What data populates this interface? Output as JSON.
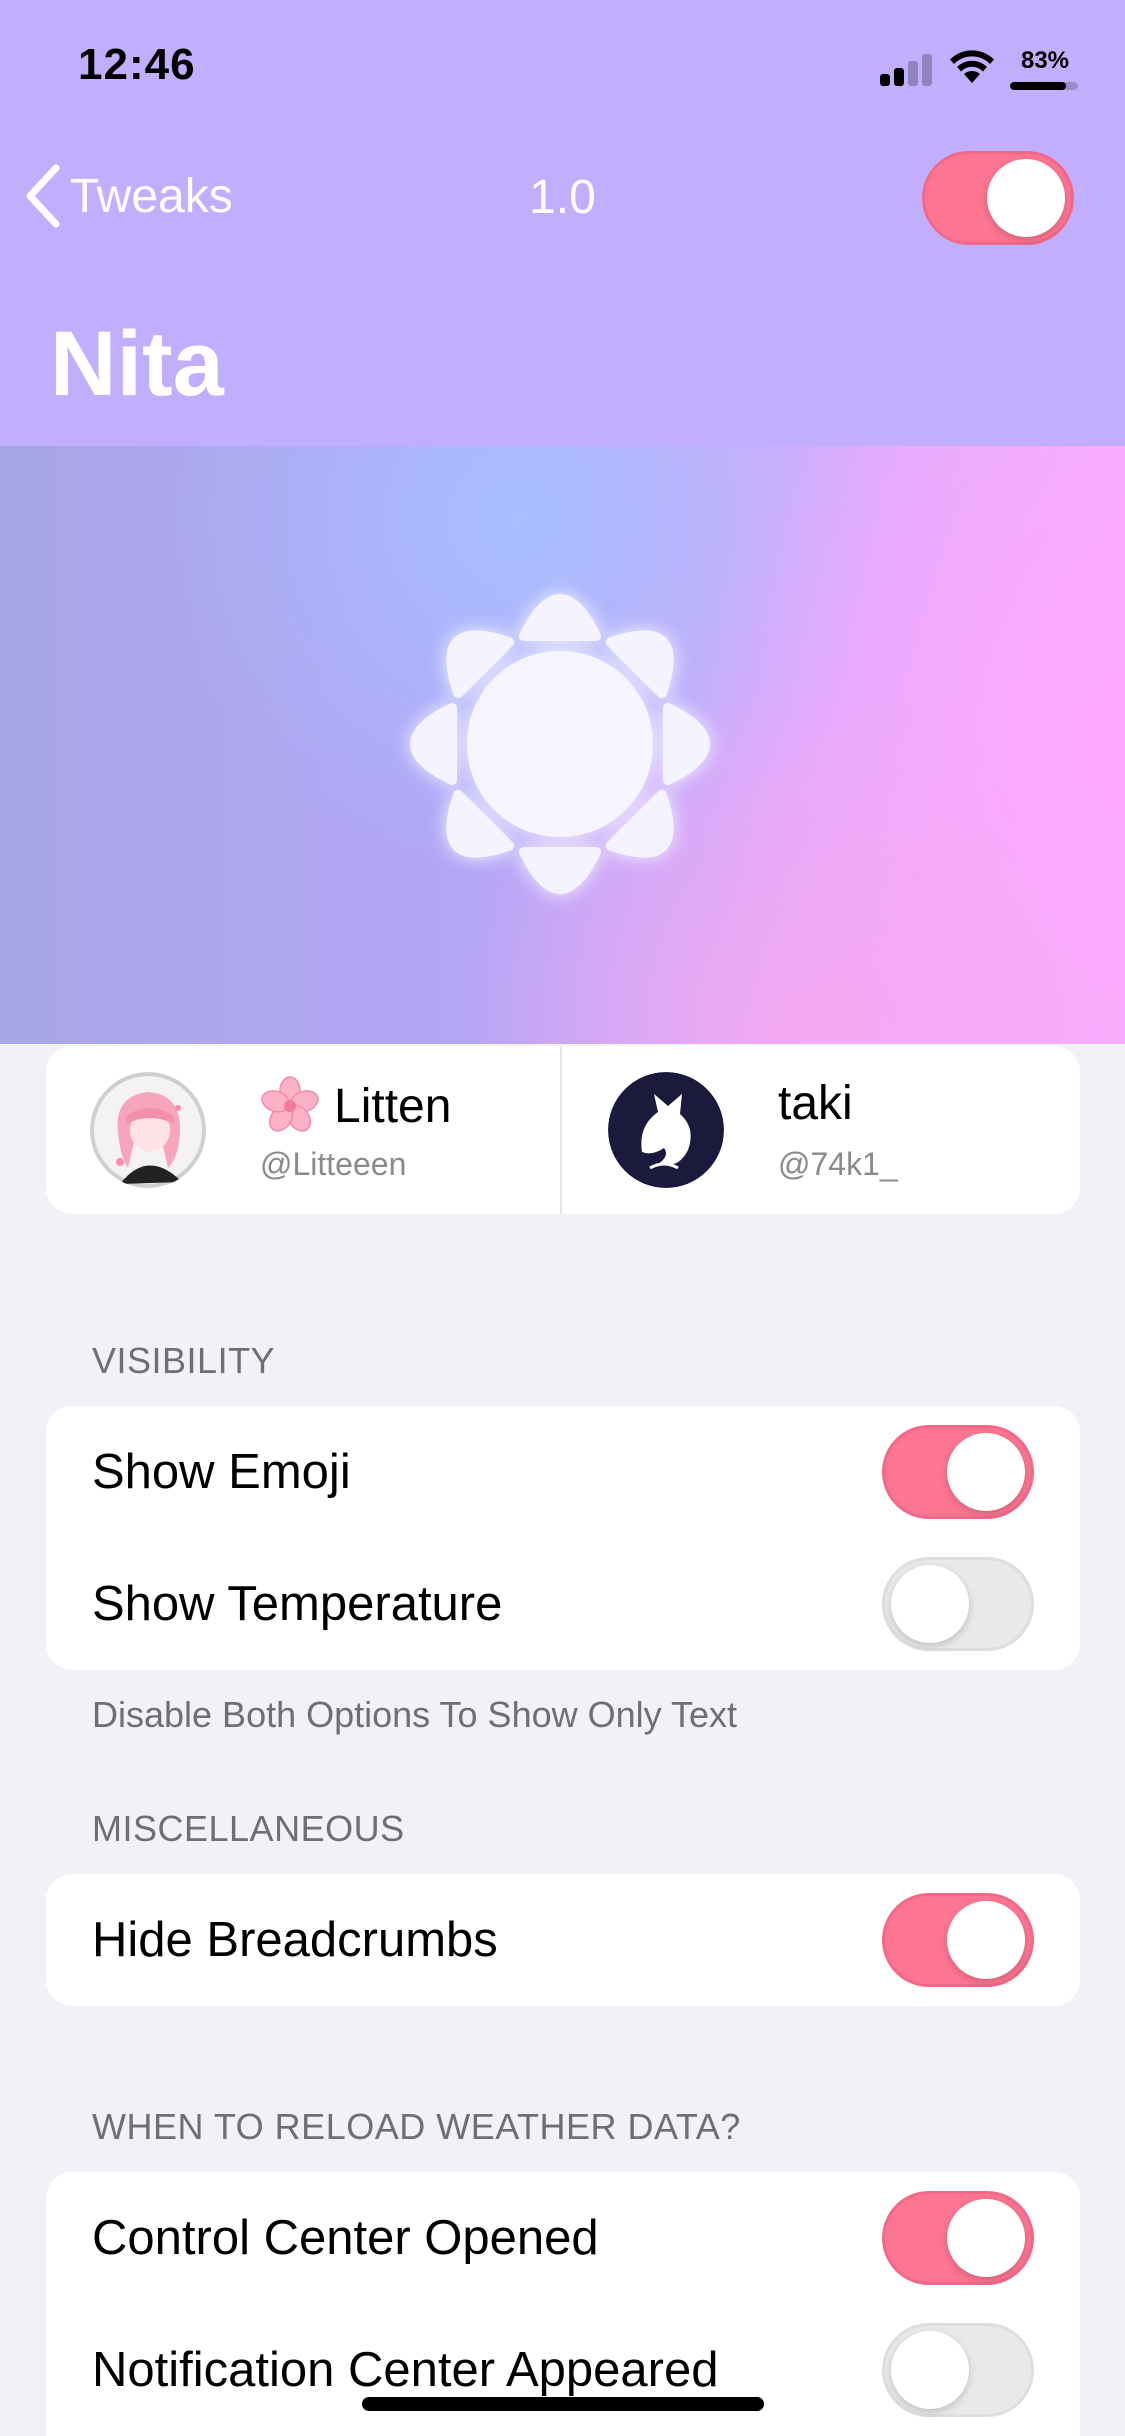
{
  "status_bar": {
    "time": "12:46",
    "battery_percent": "83%",
    "battery_level": 0.83,
    "signal_bars_active": 2,
    "signal_bars_total": 4,
    "icons": [
      "cellular-signal-icon",
      "wifi-icon",
      "battery-icon"
    ]
  },
  "nav": {
    "back_label": "Tweaks",
    "version": "1.0",
    "enabled": true
  },
  "page": {
    "title": "Nita",
    "banner_icon": "sun-icon"
  },
  "colors": {
    "header_bg": "#c1aefc",
    "toggle_on": "#fd7691",
    "toggle_off": "#e9e9eb",
    "page_bg": "#f2f1f7"
  },
  "authors": [
    {
      "emoji": "cherry-blossom-icon",
      "name": "Litten",
      "handle": "@Litteeen"
    },
    {
      "name": "taki",
      "handle": "@74k1_"
    }
  ],
  "sections": {
    "visibility": {
      "header": "VISIBILITY",
      "rows": [
        {
          "label": "Show Emoji",
          "on": true
        },
        {
          "label": "Show Temperature",
          "on": false
        }
      ],
      "footer": "Disable Both Options To Show Only Text"
    },
    "misc": {
      "header": "MISCELLANEOUS",
      "rows": [
        {
          "label": "Hide Breadcrumbs",
          "on": true
        }
      ]
    },
    "reload": {
      "header": "WHEN TO RELOAD WEATHER DATA?",
      "rows": [
        {
          "label": "Control Center Opened",
          "on": true
        },
        {
          "label": "Notification Center Appeared",
          "on": false
        }
      ]
    }
  }
}
